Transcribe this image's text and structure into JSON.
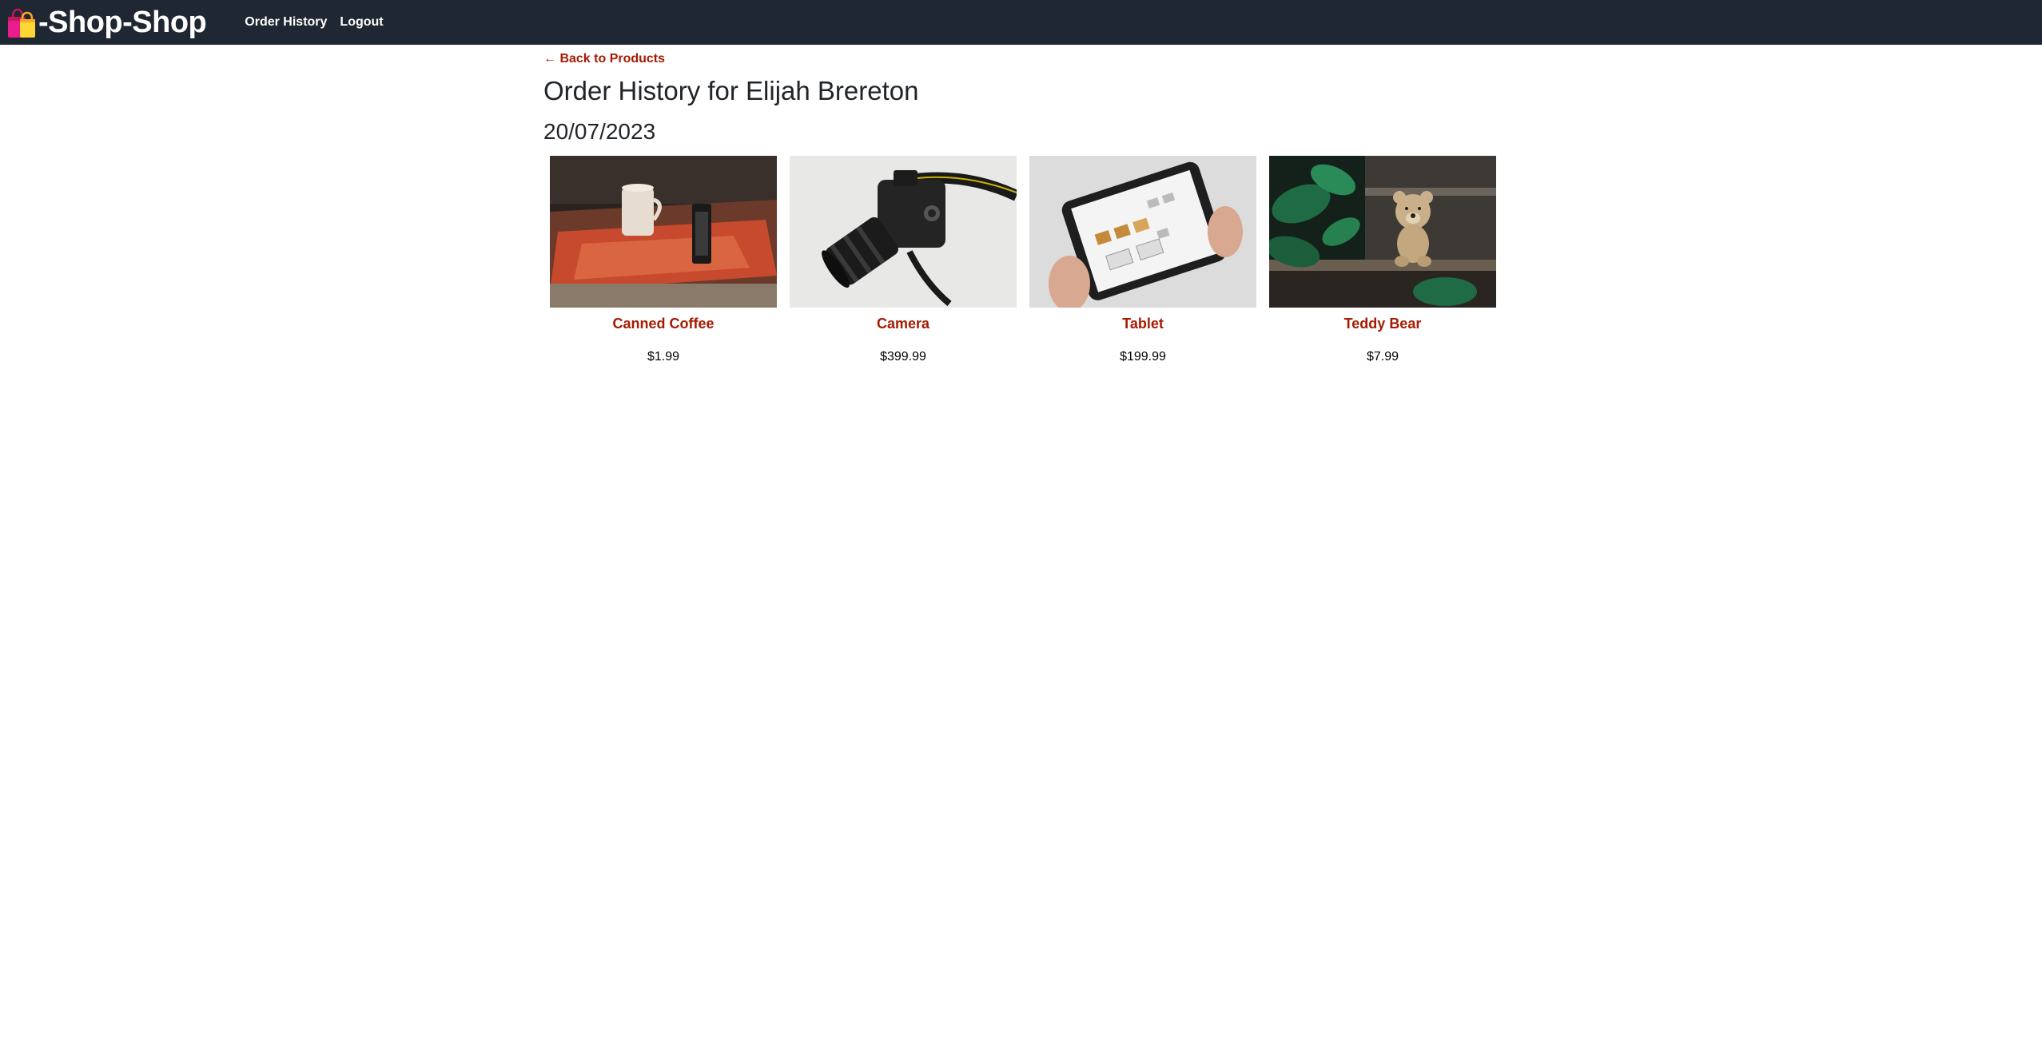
{
  "navbar": {
    "brand_icon": "shopping-bags-icon",
    "brand_text": "-Shop-Shop",
    "links": [
      {
        "label": "Order History"
      },
      {
        "label": "Logout"
      }
    ]
  },
  "main": {
    "back_link": "← Back to Products",
    "title": "Order History for Elijah Brereton",
    "orders": [
      {
        "date": "20/07/2023",
        "products": [
          {
            "name": "Canned Coffee",
            "price": "$1.99",
            "image": "canned-coffee-image"
          },
          {
            "name": "Camera",
            "price": "$399.99",
            "image": "camera-image"
          },
          {
            "name": "Tablet",
            "price": "$199.99",
            "image": "tablet-image"
          },
          {
            "name": "Teddy Bear",
            "price": "$7.99",
            "image": "teddy-bear-image"
          }
        ]
      }
    ]
  },
  "colors": {
    "navbar_bg": "#1f2733",
    "accent": "#a51a00",
    "text": "#212529"
  }
}
